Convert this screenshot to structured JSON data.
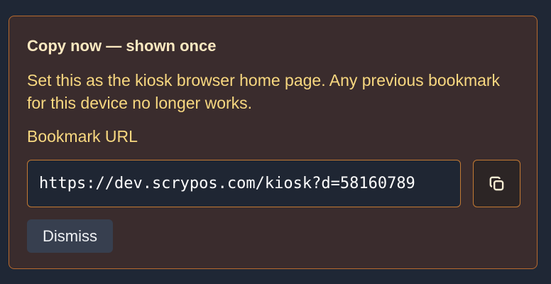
{
  "notice": {
    "heading": "Copy now — shown once",
    "message": "Set this as the kiosk browser home page. Any previous bookmark for this device no longer works.",
    "field_label": "Bookmark URL",
    "url_value": "https://dev.scrypos.com/kiosk?d=58160789",
    "copy_icon": "copy-icon",
    "dismiss_label": "Dismiss"
  },
  "colors": {
    "page_background": "#1f2735",
    "panel_background": "#3a2c2d",
    "panel_border": "#b86a2e",
    "accent_text": "#f8d880",
    "heading_text": "#fbe9c1",
    "input_background": "#1f2633",
    "button_background": "#373f4f"
  }
}
